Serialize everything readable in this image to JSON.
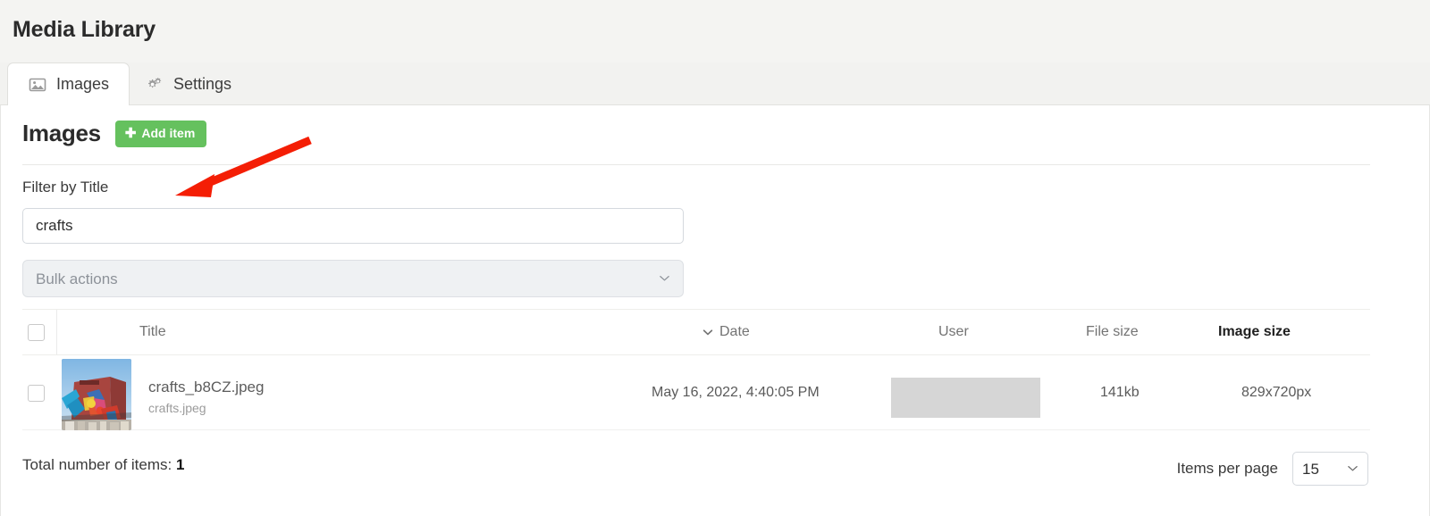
{
  "header": {
    "title": "Media Library"
  },
  "tabs": [
    {
      "label": "Images",
      "icon": "image-icon",
      "active": true
    },
    {
      "label": "Settings",
      "icon": "cogs-icon",
      "active": false
    }
  ],
  "section": {
    "title": "Images",
    "add_button": "Add item",
    "add_button_icon": "plus-icon",
    "add_button_color": "#65c15e"
  },
  "filter": {
    "label": "Filter by Title",
    "value": "crafts",
    "placeholder": ""
  },
  "bulk": {
    "selected": "Bulk actions",
    "options": [
      "Bulk actions"
    ],
    "chevron_icon": "chevron-down-icon"
  },
  "table": {
    "select_all_checked": false,
    "columns": [
      {
        "key": "title",
        "label": "Title",
        "sorted": false,
        "emphasis": false
      },
      {
        "key": "date",
        "label": "Date",
        "sorted": true,
        "sort_icon": "chevron-down-icon",
        "emphasis": false
      },
      {
        "key": "user",
        "label": "User",
        "sorted": false,
        "emphasis": false
      },
      {
        "key": "filesize",
        "label": "File size",
        "sorted": false,
        "emphasis": false
      },
      {
        "key": "imagesize",
        "label": "Image size",
        "sorted": false,
        "emphasis": true
      }
    ],
    "rows": [
      {
        "checked": false,
        "thumbnail": "street-art-mural-thumbnail",
        "title": "crafts_b8CZ.jpeg",
        "subtitle": "crafts.jpeg",
        "date": "May 16, 2022, 4:40:05 PM",
        "user": "",
        "user_redacted": true,
        "filesize": "141kb",
        "imagesize": "829x720px"
      }
    ]
  },
  "footer": {
    "total_label": "Total number of items:",
    "total_value": "1",
    "items_per_page_label": "Items per page",
    "items_per_page_value": "15",
    "items_per_page_options": [
      "15"
    ],
    "chevron_icon": "chevron-down-icon"
  },
  "annotation": {
    "arrow_color": "#f41e05",
    "arrow_from": "345,158",
    "arrow_to": "198,219"
  }
}
